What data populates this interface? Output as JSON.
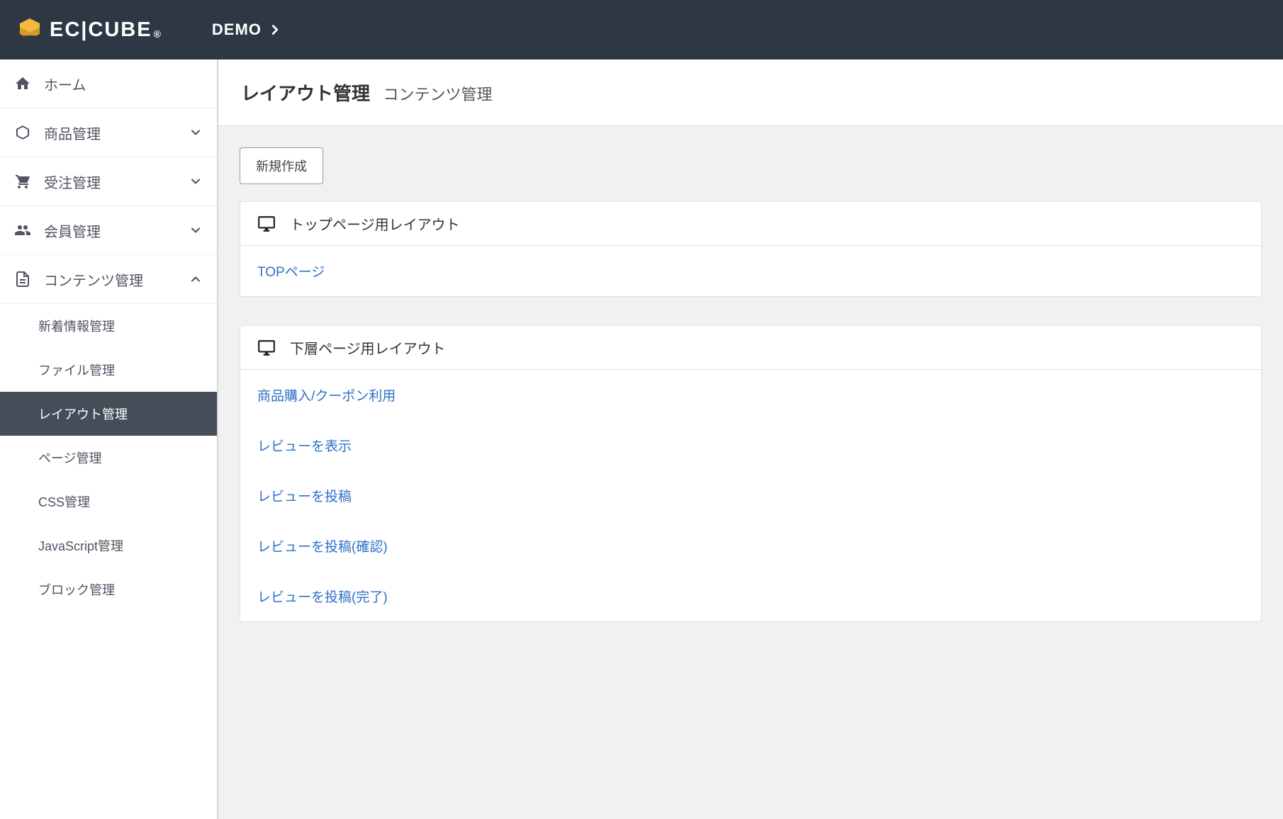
{
  "header": {
    "logo_text": "EC|CUBE",
    "demo_label": "DEMO"
  },
  "sidebar": {
    "items": [
      {
        "label": "ホーム",
        "iconName": "home-icon",
        "expandable": false
      },
      {
        "label": "商品管理",
        "iconName": "cube-icon",
        "expandable": true,
        "expanded": false
      },
      {
        "label": "受注管理",
        "iconName": "cart-icon",
        "expandable": true,
        "expanded": false
      },
      {
        "label": "会員管理",
        "iconName": "users-icon",
        "expandable": true,
        "expanded": false
      },
      {
        "label": "コンテンツ管理",
        "iconName": "file-icon",
        "expandable": true,
        "expanded": true,
        "children": [
          {
            "label": "新着情報管理",
            "active": false
          },
          {
            "label": "ファイル管理",
            "active": false
          },
          {
            "label": "レイアウト管理",
            "active": true
          },
          {
            "label": "ページ管理",
            "active": false
          },
          {
            "label": "CSS管理",
            "active": false
          },
          {
            "label": "JavaScript管理",
            "active": false
          },
          {
            "label": "ブロック管理",
            "active": false
          }
        ]
      }
    ]
  },
  "page": {
    "title": "レイアウト管理",
    "subtitle": "コンテンツ管理",
    "new_button": "新規作成"
  },
  "panels": [
    {
      "title": "トップページ用レイアウト",
      "items": [
        {
          "label": "TOPページ"
        }
      ]
    },
    {
      "title": "下層ページ用レイアウト",
      "items": [
        {
          "label": "商品購入/クーポン利用"
        },
        {
          "label": "レビューを表示"
        },
        {
          "label": "レビューを投稿"
        },
        {
          "label": "レビューを投稿(確認)"
        },
        {
          "label": "レビューを投稿(完了)"
        }
      ]
    }
  ]
}
